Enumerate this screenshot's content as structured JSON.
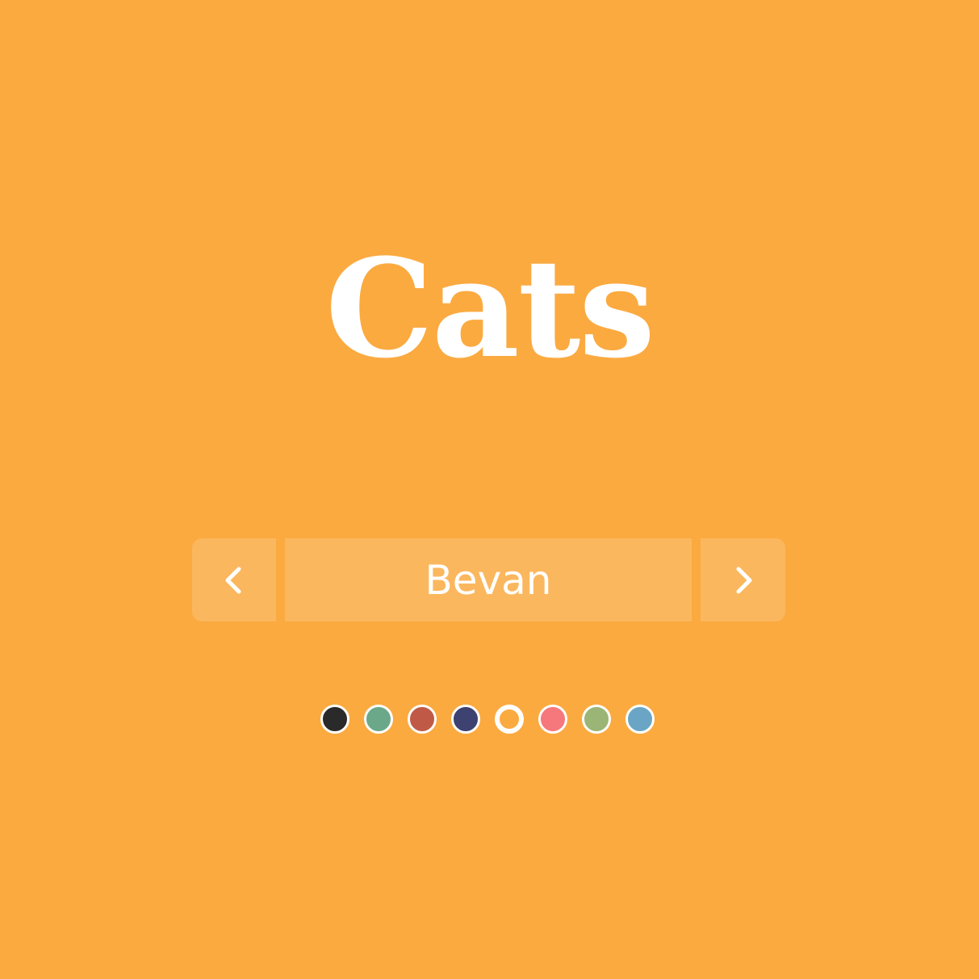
{
  "page": {
    "background": "#fbaa40"
  },
  "title": "Cats",
  "selector": {
    "prev_icon": "chevron-left-icon",
    "font_name": "Bevan",
    "next_icon": "chevron-right-icon"
  },
  "color_dots": [
    {
      "name": "dark",
      "color": "#2a2a2a",
      "active": false
    },
    {
      "name": "green",
      "color": "#6aa889",
      "active": false
    },
    {
      "name": "red",
      "color": "#c05a47",
      "active": false
    },
    {
      "name": "navy",
      "color": "#3d4270",
      "active": false
    },
    {
      "name": "orange",
      "color": "#fbaa40",
      "active": true
    },
    {
      "name": "pink",
      "color": "#f6787c",
      "active": false
    },
    {
      "name": "olive",
      "color": "#9ab575",
      "active": false
    },
    {
      "name": "blue",
      "color": "#6ba5c5",
      "active": false
    }
  ]
}
